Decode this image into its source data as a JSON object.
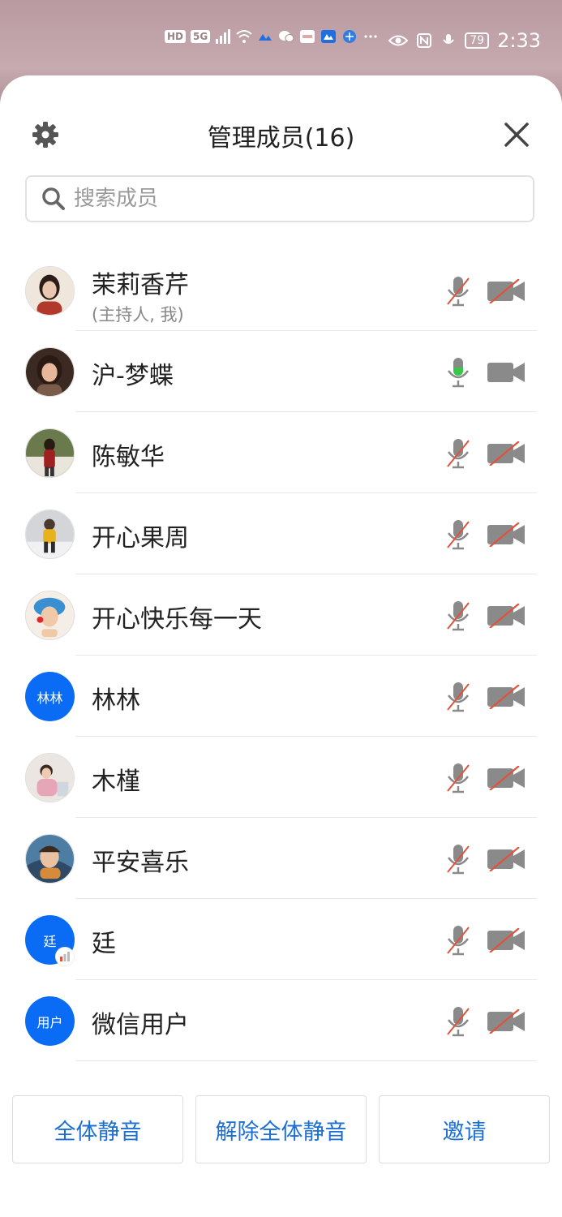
{
  "status_bar": {
    "left_chips": [
      "HD",
      "5G"
    ],
    "time": "2:33",
    "battery": "79",
    "icons": [
      "signal-icon",
      "wifi-icon",
      "app-icon",
      "wechat-icon",
      "app-icon",
      "app-icon",
      "app-icon",
      "more-icon",
      "eye-icon",
      "nfc-icon",
      "mic-icon"
    ]
  },
  "header": {
    "title": "管理成员(16)"
  },
  "search": {
    "placeholder": "搜索成员"
  },
  "members": [
    {
      "name": "茉莉香芹",
      "sub": "(主持人, 我)",
      "avatar_text": "",
      "mic": "muted",
      "cam": "off"
    },
    {
      "name": "沪-梦蝶",
      "sub": "",
      "avatar_text": "",
      "mic": "active",
      "cam": "on"
    },
    {
      "name": "陈敏华",
      "sub": "",
      "avatar_text": "",
      "mic": "muted",
      "cam": "off"
    },
    {
      "name": "开心果周",
      "sub": "",
      "avatar_text": "",
      "mic": "muted",
      "cam": "off"
    },
    {
      "name": "开心快乐每一天",
      "sub": "",
      "avatar_text": "",
      "mic": "muted",
      "cam": "off"
    },
    {
      "name": "林林",
      "sub": "",
      "avatar_text": "林林",
      "mic": "muted",
      "cam": "off"
    },
    {
      "name": "木槿",
      "sub": "",
      "avatar_text": "",
      "mic": "muted",
      "cam": "off"
    },
    {
      "name": "平安喜乐",
      "sub": "",
      "avatar_text": "",
      "mic": "muted",
      "cam": "off"
    },
    {
      "name": "廷",
      "sub": "",
      "avatar_text": "廷",
      "mic": "muted",
      "cam": "off"
    },
    {
      "name": "微信用户",
      "sub": "",
      "avatar_text": "用户",
      "mic": "muted",
      "cam": "off"
    }
  ],
  "footer": {
    "mute_all": "全体静音",
    "unmute_all": "解除全体静音",
    "invite": "邀请"
  },
  "colors": {
    "accent": "#1c6fd3",
    "avatar_blue": "#0a6cf5",
    "mute_red": "#e0533a",
    "speaking_green": "#37c84a"
  }
}
